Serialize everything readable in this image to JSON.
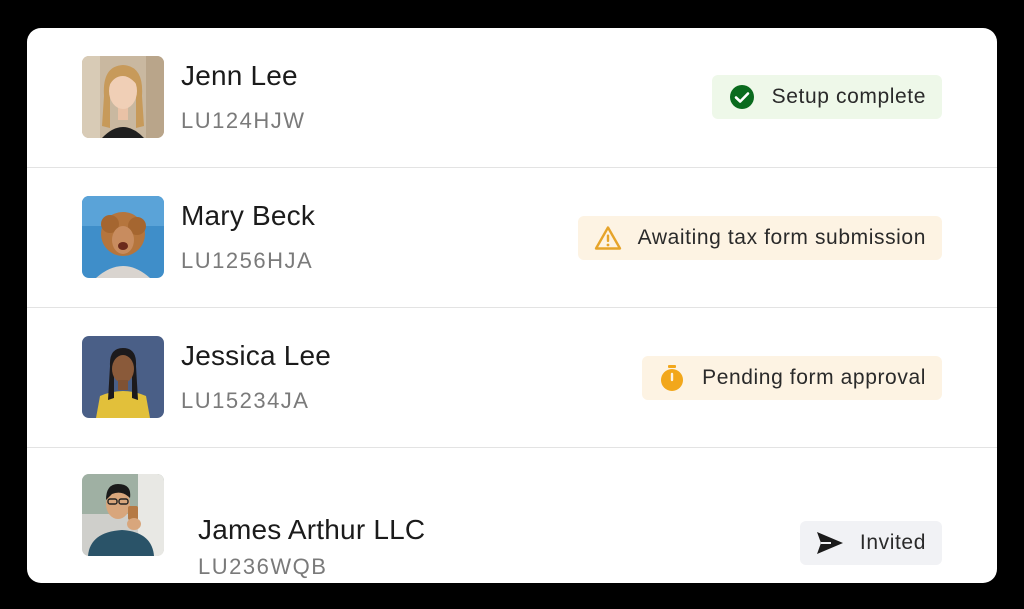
{
  "contacts": [
    {
      "name": "Jenn Lee",
      "code": "LU124HJW",
      "status": "Setup complete",
      "status_icon": "check-circle-icon",
      "status_color": "#0a6b1e",
      "badge_bg": "#eef8e9"
    },
    {
      "name": "Mary Beck",
      "code": "LU1256HJA",
      "status": "Awaiting tax form submission",
      "status_icon": "warning-triangle-icon",
      "status_color": "#e6a42a",
      "badge_bg": "#fdf3e3"
    },
    {
      "name": "Jessica Lee",
      "code": "LU15234JA",
      "status": "Pending form approval",
      "status_icon": "stopwatch-icon",
      "status_color": "#f2a71b",
      "badge_bg": "#fdf3e3"
    },
    {
      "name": "James Arthur LLC",
      "code": "LU236WQB",
      "status": "Invited",
      "status_icon": "send-icon",
      "status_color": "#1b1b1b",
      "badge_bg": "#f1f2f5"
    }
  ]
}
